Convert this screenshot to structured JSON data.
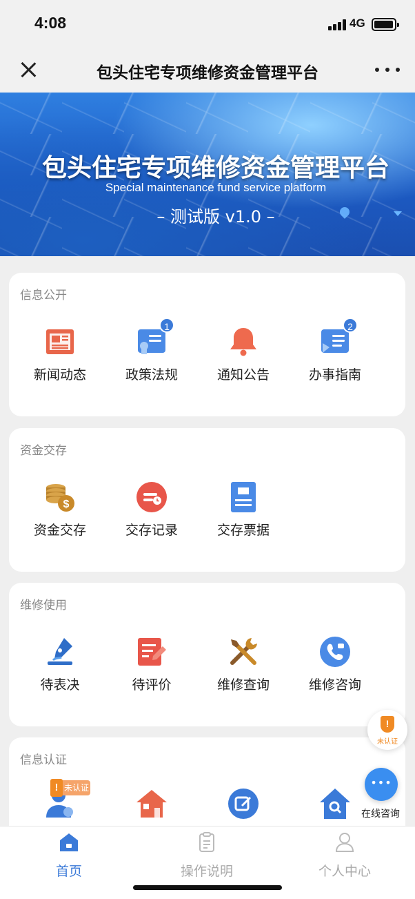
{
  "status_bar": {
    "time": "4:08",
    "network": "4G"
  },
  "nav": {
    "title": "包头住宅专项维修资金管理平台"
  },
  "banner": {
    "title": "包头住宅专项维修资金管理平台",
    "subtitle": "Special maintenance fund service platform",
    "version": "– 测试版 v1.0 –"
  },
  "sections": [
    {
      "title": "信息公开",
      "items": [
        {
          "label": "新闻动态",
          "icon": "newspaper-icon",
          "color": "#e8664a"
        },
        {
          "label": "政策法规",
          "icon": "certificate-icon",
          "color": "#3b7ad8",
          "badge": "1"
        },
        {
          "label": "通知公告",
          "icon": "bell-icon",
          "color": "#ee6a4e"
        },
        {
          "label": "办事指南",
          "icon": "guide-icon",
          "color": "#3b7ad8",
          "badge": "2"
        }
      ]
    },
    {
      "title": "资金交存",
      "items": [
        {
          "label": "资金交存",
          "icon": "coins-icon",
          "color": "#c98a2a"
        },
        {
          "label": "交存记录",
          "icon": "record-icon",
          "color": "#e8564a"
        },
        {
          "label": "交存票据",
          "icon": "receipt-icon",
          "color": "#3b7ad8"
        }
      ]
    },
    {
      "title": "维修使用",
      "items": [
        {
          "label": "待表决",
          "icon": "pen-icon",
          "color": "#2f6ec8"
        },
        {
          "label": "待评价",
          "icon": "edit-doc-icon",
          "color": "#e8564a"
        },
        {
          "label": "维修查询",
          "icon": "tools-icon",
          "color": "#c98a2a"
        },
        {
          "label": "维修咨询",
          "icon": "phone-icon",
          "color": "#3b7ad8"
        }
      ]
    },
    {
      "title": "信息认证",
      "items": [
        {
          "label": "",
          "icon": "user-icon",
          "color": "#3b7ad8",
          "tag": "未认证"
        },
        {
          "label": "",
          "icon": "house-icon",
          "color": "#e8664a"
        },
        {
          "label": "",
          "icon": "edit-circle-icon",
          "color": "#3b7ad8"
        },
        {
          "label": "",
          "icon": "home-search-icon",
          "color": "#3b7ad8"
        }
      ]
    }
  ],
  "float_auth": {
    "label": "未认证",
    "color": "#f08a24"
  },
  "float_chat": {
    "label": "在线咨询",
    "color": "#3a8ef0"
  },
  "tabbar": [
    {
      "label": "首页",
      "icon": "home-icon",
      "active": true
    },
    {
      "label": "操作说明",
      "icon": "clipboard-icon",
      "active": false
    },
    {
      "label": "个人中心",
      "icon": "person-icon",
      "active": false
    }
  ],
  "colors": {
    "accent": "#3b7ad8",
    "card": "#ffffff",
    "background": "#efefef"
  }
}
